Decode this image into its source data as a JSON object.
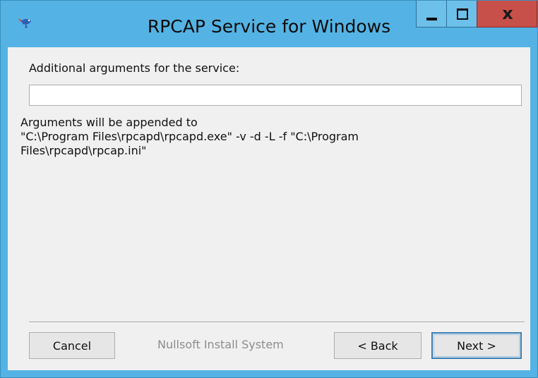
{
  "window": {
    "title": "RPCAP Service for Windows",
    "icon": "nsis-installer-icon",
    "controls": {
      "minimize": "minimize-icon",
      "maximize": "maximize-icon",
      "close": "x"
    }
  },
  "form": {
    "args_label": "Additional arguments for the service:",
    "args_value": "",
    "info_lines": [
      "Arguments will be appended to",
      " \"C:\\Program Files\\rpcapd\\rpcapd.exe\" -v -d -L -f \"C:\\Program",
      "Files\\rpcapd\\rpcap.ini\""
    ]
  },
  "footer": {
    "branding": "Nullsoft Install System",
    "cancel_label": "Cancel",
    "back_label": "< Back",
    "next_label": "Next >"
  },
  "colors": {
    "frame": "#54b3e4",
    "close_button": "#c7504a",
    "client_background": "#f0f0f0"
  }
}
